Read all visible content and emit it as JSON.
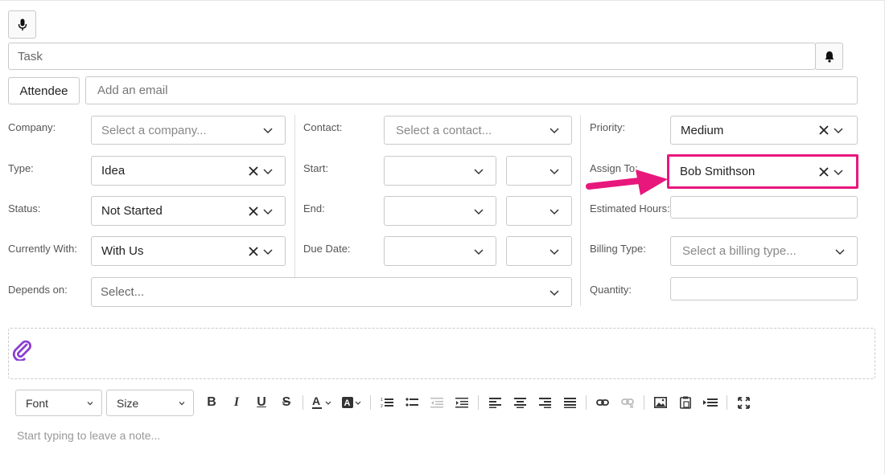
{
  "task": {
    "placeholder": "Task"
  },
  "attendee": {
    "button_label": "Attendee",
    "email_placeholder": "Add an email"
  },
  "columns": {
    "left": [
      {
        "label": "Company:",
        "placeholder": "Select a company...",
        "value": ""
      },
      {
        "label": "Type:",
        "value": "Idea"
      },
      {
        "label": "Status:",
        "value": "Not Started"
      },
      {
        "label": "Currently With:",
        "value": "With Us"
      }
    ],
    "middle": [
      {
        "label": "Contact:",
        "placeholder": "Select a contact..."
      },
      {
        "label": "Start:"
      },
      {
        "label": "End:"
      },
      {
        "label": "Due Date:"
      }
    ],
    "right": [
      {
        "label": "Priority:",
        "value": "Medium"
      },
      {
        "label": "Assign To:",
        "value": "Bob Smithson"
      },
      {
        "label": "Estimated Hours:",
        "value": ""
      },
      {
        "label": "Billing Type:",
        "placeholder": "Select a billing type..."
      },
      {
        "label": "Quantity:",
        "value": ""
      }
    ]
  },
  "depends_on": {
    "label": "Depends on:",
    "placeholder": "Select..."
  },
  "editor": {
    "font_label": "Font",
    "size_label": "Size",
    "note_placeholder": "Start typing to leave a note...",
    "toolbar_icons": [
      "bold-icon",
      "italic-icon",
      "underline-icon",
      "strikethrough-icon",
      "font-color-icon",
      "highlight-color-icon",
      "ordered-list-icon",
      "unordered-list-icon",
      "outdent-icon",
      "indent-icon",
      "align-left-icon",
      "align-center-icon",
      "align-right-icon",
      "align-justify-icon",
      "link-icon",
      "unlink-icon",
      "image-icon",
      "paste-icon",
      "insert-table-icon",
      "fullscreen-icon"
    ]
  },
  "annotation": {
    "color": "#e8177c",
    "target": "Assign To"
  },
  "colors": {
    "accent": "#e8177c",
    "attach_icon": "#8a3fd1"
  }
}
